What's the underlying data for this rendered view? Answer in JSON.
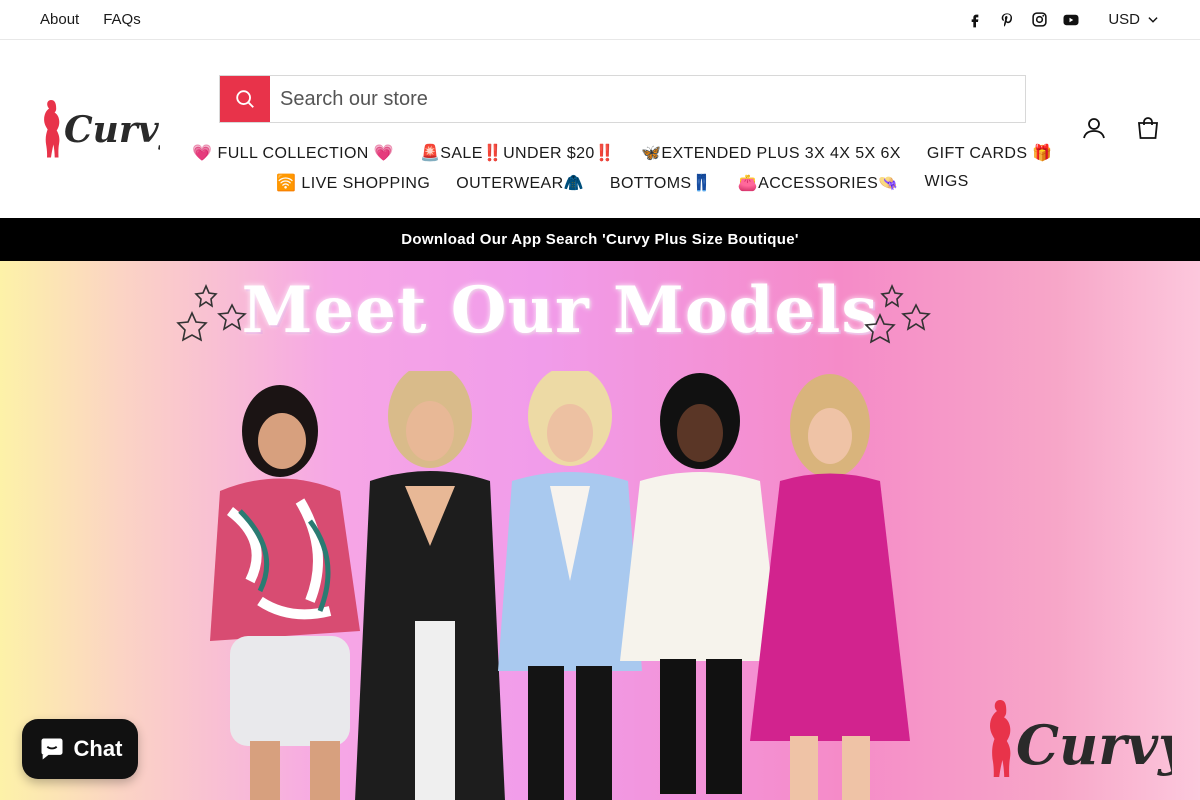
{
  "topbar": {
    "links": [
      "About",
      "FAQs"
    ],
    "social_icons": [
      "facebook-icon",
      "pinterest-icon",
      "instagram-icon",
      "youtube-icon"
    ],
    "currency": "USD"
  },
  "header": {
    "logo_text": "Curvy",
    "search_placeholder": "Search our store",
    "nav_row1": [
      "💗 FULL COLLECTION 💗",
      "🚨SALE‼️UNDER $20‼️",
      "🦋EXTENDED PLUS 3X 4X 5X 6X",
      "GIFT CARDS 🎁"
    ],
    "nav_row2": [
      "🛜 LIVE SHOPPING",
      "OUTERWEAR🧥",
      "BOTTOMS👖",
      "👛ACCESSORIES👒",
      "WIGS"
    ]
  },
  "announcement": "Download Our App Search 'Curvy Plus Size Boutique'",
  "hero": {
    "title": "Meet Our Models",
    "logo_text": "Curvy"
  },
  "chat": {
    "label": "Chat"
  },
  "colors": {
    "accent": "#e8334a",
    "announce_bg": "#000000"
  }
}
